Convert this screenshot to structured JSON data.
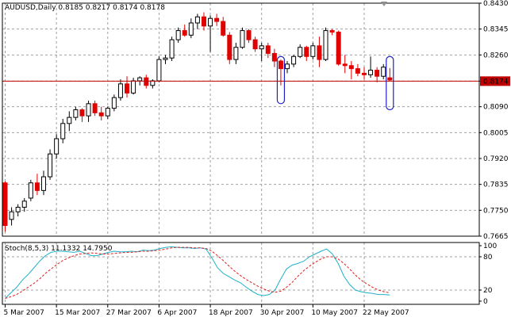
{
  "header": {
    "symbol_line": "AUDUSD,Daily  0.8185 0.8217 0.8174 0.8178"
  },
  "colors": {
    "bull": "#000000",
    "bear": "#e00000",
    "grid": "#a0a0a0",
    "price_line": "#c00000",
    "price_tag_bg": "#c00000",
    "stoch_main": "#20b0c8",
    "stoch_signal": "#e02020",
    "marker": "#2020c0"
  },
  "chart_data": [
    {
      "type": "candlestick",
      "title": "AUDUSD,Daily",
      "ohlc_readout": [
        0.8185,
        0.8217,
        0.8174,
        0.8178
      ],
      "ylim": [
        0.7665,
        0.843
      ],
      "y_ticks": [
        "0.8430",
        "0.8345",
        "0.8260",
        "0.8174",
        "0.8090",
        "0.8005",
        "0.7920",
        "0.7835",
        "0.7750",
        "0.7665"
      ],
      "current_price": 0.8174,
      "current_price_label": "0.8174",
      "x_ticks": [
        {
          "label": "5 Mar 2007",
          "index": 0
        },
        {
          "label": "15 Mar 2007",
          "index": 8
        },
        {
          "label": "27 Mar 2007",
          "index": 16
        },
        {
          "label": "6 Apr 2007",
          "index": 24
        },
        {
          "label": "18 Apr 2007",
          "index": 32
        },
        {
          "label": "30 Apr 2007",
          "index": 40
        },
        {
          "label": "10 May 2007",
          "index": 48
        },
        {
          "label": "22 May 2007",
          "index": 56
        }
      ],
      "candles": [
        [
          0.784,
          0.7845,
          0.768,
          0.77
        ],
        [
          0.772,
          0.776,
          0.77,
          0.7745
        ],
        [
          0.7745,
          0.777,
          0.773,
          0.776
        ],
        [
          0.776,
          0.779,
          0.7745,
          0.778
        ],
        [
          0.779,
          0.785,
          0.778,
          0.784
        ],
        [
          0.784,
          0.787,
          0.78,
          0.7815
        ],
        [
          0.7815,
          0.788,
          0.78,
          0.786
        ],
        [
          0.786,
          0.795,
          0.785,
          0.7935
        ],
        [
          0.7935,
          0.8,
          0.792,
          0.7985
        ],
        [
          0.7985,
          0.805,
          0.797,
          0.8035
        ],
        [
          0.8035,
          0.8075,
          0.801,
          0.8055
        ],
        [
          0.8055,
          0.809,
          0.8045,
          0.808
        ],
        [
          0.808,
          0.8085,
          0.804,
          0.806
        ],
        [
          0.806,
          0.811,
          0.804,
          0.81
        ],
        [
          0.81,
          0.811,
          0.806,
          0.807
        ],
        [
          0.807,
          0.809,
          0.8045,
          0.806
        ],
        [
          0.806,
          0.809,
          0.805,
          0.8085
        ],
        [
          0.8085,
          0.813,
          0.8075,
          0.812
        ],
        [
          0.812,
          0.818,
          0.811,
          0.8165
        ],
        [
          0.8165,
          0.819,
          0.812,
          0.8135
        ],
        [
          0.8135,
          0.8185,
          0.813,
          0.8175
        ],
        [
          0.8175,
          0.819,
          0.816,
          0.8185
        ],
        [
          0.8185,
          0.8195,
          0.815,
          0.816
        ],
        [
          0.816,
          0.818,
          0.815,
          0.8175
        ],
        [
          0.8175,
          0.8255,
          0.817,
          0.8245
        ],
        [
          0.8245,
          0.826,
          0.823,
          0.825
        ],
        [
          0.825,
          0.832,
          0.824,
          0.831
        ],
        [
          0.831,
          0.835,
          0.83,
          0.834
        ],
        [
          0.834,
          0.836,
          0.832,
          0.8325
        ],
        [
          0.8325,
          0.838,
          0.8315,
          0.8365
        ],
        [
          0.8365,
          0.8395,
          0.8345,
          0.8385
        ],
        [
          0.8385,
          0.84,
          0.834,
          0.8355
        ],
        [
          0.8355,
          0.839,
          0.827,
          0.838
        ],
        [
          0.838,
          0.8395,
          0.8355,
          0.837
        ],
        [
          0.837,
          0.8385,
          0.832,
          0.8325
        ],
        [
          0.8325,
          0.8335,
          0.823,
          0.8245
        ],
        [
          0.8245,
          0.83,
          0.823,
          0.8285
        ],
        [
          0.8285,
          0.835,
          0.828,
          0.834
        ],
        [
          0.834,
          0.8345,
          0.83,
          0.831
        ],
        [
          0.831,
          0.832,
          0.827,
          0.828
        ],
        [
          0.828,
          0.83,
          0.824,
          0.829
        ],
        [
          0.829,
          0.83,
          0.825,
          0.8265
        ],
        [
          0.8265,
          0.828,
          0.822,
          0.824
        ],
        [
          0.824,
          0.8245,
          0.816,
          0.8215
        ],
        [
          0.8215,
          0.824,
          0.82,
          0.823
        ],
        [
          0.823,
          0.826,
          0.822,
          0.8255
        ],
        [
          0.8255,
          0.8295,
          0.825,
          0.8285
        ],
        [
          0.8285,
          0.829,
          0.824,
          0.8255
        ],
        [
          0.8255,
          0.83,
          0.8245,
          0.829
        ],
        [
          0.829,
          0.832,
          0.822,
          0.8245
        ],
        [
          0.8245,
          0.835,
          0.824,
          0.834
        ],
        [
          0.834,
          0.8345,
          0.8325,
          0.8335
        ],
        [
          0.8335,
          0.834,
          0.8225,
          0.823
        ],
        [
          0.823,
          0.826,
          0.82,
          0.8225
        ],
        [
          0.8225,
          0.824,
          0.818,
          0.8215
        ],
        [
          0.8215,
          0.823,
          0.819,
          0.82
        ],
        [
          0.82,
          0.822,
          0.818,
          0.8195
        ],
        [
          0.8195,
          0.8255,
          0.8185,
          0.821
        ],
        [
          0.821,
          0.822,
          0.817,
          0.819
        ],
        [
          0.819,
          0.823,
          0.818,
          0.822
        ],
        [
          0.8185,
          0.8217,
          0.8174,
          0.8178
        ]
      ],
      "markers": [
        {
          "index": 43,
          "top": 0.8255,
          "bottom": 0.81
        },
        {
          "index": 60,
          "top": 0.8255,
          "bottom": 0.808
        }
      ]
    },
    {
      "type": "line",
      "title": "Stoch(8,5,3) 11.1332 14.7950",
      "ylim": [
        0,
        100
      ],
      "y_ticks": [
        "100",
        "80",
        "20",
        "0"
      ],
      "series": [
        {
          "values": [
            5,
            15,
            25,
            38,
            48,
            60,
            72,
            82,
            88,
            90,
            90,
            89,
            88,
            90,
            86,
            82,
            82,
            85,
            88,
            90,
            89,
            89,
            90,
            89,
            92,
            91,
            92,
            95,
            97,
            98,
            97,
            96,
            96,
            95,
            96,
            94,
            78,
            60,
            50,
            44,
            38,
            33,
            25,
            18,
            12,
            10,
            12,
            20,
            40,
            58,
            65,
            68,
            72,
            80,
            85,
            90,
            94,
            85,
            68,
            45,
            30,
            20,
            17,
            15,
            14,
            12,
            12,
            11
          ]
        },
        {
          "values": [
            5,
            8,
            12,
            18,
            25,
            32,
            40,
            50,
            58,
            66,
            73,
            78,
            82,
            85,
            86,
            87,
            86,
            85,
            85,
            86,
            87,
            88,
            88,
            89,
            90,
            90,
            91,
            92,
            94,
            96,
            97,
            97,
            97,
            96,
            96,
            95,
            90,
            82,
            73,
            63,
            54,
            46,
            39,
            33,
            27,
            22,
            18,
            16,
            18,
            25,
            34,
            45,
            55,
            63,
            70,
            76,
            80,
            80,
            76,
            68,
            58,
            47,
            38,
            31,
            25,
            20,
            17,
            15
          ]
        }
      ]
    }
  ]
}
